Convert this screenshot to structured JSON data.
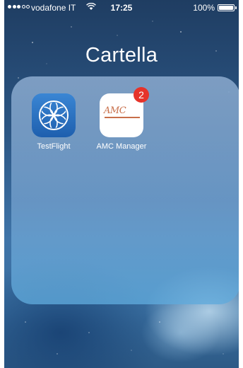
{
  "status_bar": {
    "carrier": "vodafone IT",
    "time": "17:25",
    "battery_percent": "100%",
    "signal_bars_filled": 3,
    "signal_bars_total": 5,
    "battery_level": 1.0
  },
  "folder": {
    "title": "Cartella",
    "apps": [
      {
        "label": "TestFlight",
        "icon": "testflight-icon",
        "badge": ""
      },
      {
        "label": "AMC Manager",
        "icon": "amc-manager-icon",
        "icon_text": "AMC",
        "badge": "2"
      }
    ]
  },
  "colors": {
    "badge": "#e6332a",
    "testflight_blue": "#2a72c2",
    "amc_brand": "#c86f4a"
  }
}
